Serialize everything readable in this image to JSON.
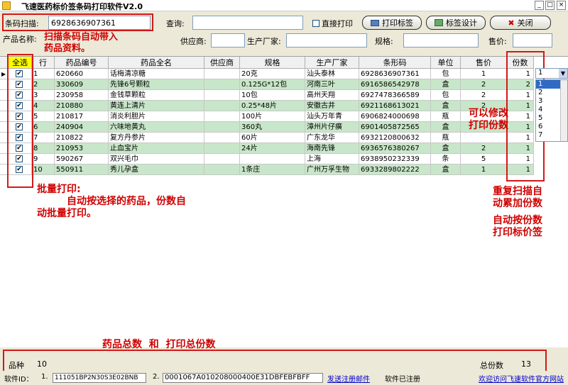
{
  "window": {
    "title": "飞速医药标价签条码打印软件V2.0",
    "min": "_",
    "max": "□",
    "close": "×"
  },
  "toolbar": {
    "scan_label": "条码扫描:",
    "scan_value": "6928636907361",
    "query_label": "查询:",
    "direct_print": "直接打印",
    "print_btn": "打印标签",
    "design_btn": "标签设计",
    "close_btn": "关闭"
  },
  "filters": {
    "name_label": "产品名称:",
    "supplier_label": "供应商:",
    "maker_label": "生产厂家:",
    "spec_label": "规格:",
    "price_label": "售价:"
  },
  "annotations": {
    "scan": "扫描条码自动带入\n药品资料。",
    "modify": "可以修改\n打印份数",
    "batch_title": "批量打印:",
    "batch_body": "自动按选择的药品，份数自\n动批量打印。",
    "repeat": "重复扫描自\n动累加份数",
    "auto": "自动按份数\n打印标价签",
    "total": "药品总数  和  打印总份数"
  },
  "table": {
    "headers": [
      "全选",
      "行",
      "药品编号",
      "药品全名",
      "供应商",
      "规格",
      "生产厂家",
      "条形码",
      "单位",
      "售价",
      "份数"
    ],
    "rows": [
      {
        "row": "1",
        "code": "620660",
        "name": "话梅清凉糖",
        "supplier": "",
        "spec": "20克",
        "maker": "汕头泰林",
        "barcode": "6928636907361",
        "unit": "包",
        "price": "1",
        "qty": "1"
      },
      {
        "row": "2",
        "code": "330609",
        "name": "先锋6号颗粒",
        "supplier": "",
        "spec": "0.125G*12包",
        "maker": "河南三叶",
        "barcode": "6916586542978",
        "unit": "盒",
        "price": "2",
        "qty": "2"
      },
      {
        "row": "3",
        "code": "230958",
        "name": "金钱草颗粒",
        "supplier": "",
        "spec": "10包",
        "maker": "高州天翔",
        "barcode": "6927478366589",
        "unit": "包",
        "price": "2",
        "qty": "1"
      },
      {
        "row": "4",
        "code": "210880",
        "name": "黄连上清片",
        "supplier": "",
        "spec": "0.25*48片",
        "maker": "安徽古井",
        "barcode": "6921168613021",
        "unit": "盒",
        "price": "2",
        "qty": "1"
      },
      {
        "row": "5",
        "code": "210817",
        "name": "消炎利胆片",
        "supplier": "",
        "spec": "100片",
        "maker": "汕头万年青",
        "barcode": "6906824000698",
        "unit": "瓶",
        "price": "",
        "qty": "1"
      },
      {
        "row": "6",
        "code": "240904",
        "name": "六味地黄丸",
        "supplier": "",
        "spec": "360丸",
        "maker": "漳州片仔癀",
        "barcode": "6901405872565",
        "unit": "盒",
        "price": "",
        "qty": "1"
      },
      {
        "row": "7",
        "code": "210822",
        "name": "复方丹参片",
        "supplier": "",
        "spec": "60片",
        "maker": "广东龙华",
        "barcode": "6932120800632",
        "unit": "瓶",
        "price": "",
        "qty": "1"
      },
      {
        "row": "8",
        "code": "210953",
        "name": "止血宝片",
        "supplier": "",
        "spec": "24片",
        "maker": "海南先锋",
        "barcode": "6936576380267",
        "unit": "盒",
        "price": "2",
        "qty": "1"
      },
      {
        "row": "9",
        "code": "590267",
        "name": "双兴毛巾",
        "supplier": "",
        "spec": "",
        "maker": "上海",
        "barcode": "6938950232339",
        "unit": "条",
        "price": "5",
        "qty": "1"
      },
      {
        "row": "10",
        "code": "550911",
        "name": "秀儿孕盒",
        "supplier": "",
        "spec": "1条庄",
        "maker": "广州万孚生物",
        "barcode": "6933289802222",
        "unit": "盒",
        "price": "1",
        "qty": "1"
      }
    ]
  },
  "dropdown": {
    "selected": "1",
    "options": [
      "1",
      "2",
      "3",
      "4",
      "5",
      "6",
      "7"
    ]
  },
  "status": {
    "kinds_label": "品种",
    "kinds_value": "10",
    "total_label": "总份数",
    "total_value": "13"
  },
  "footer": {
    "id_label": "软件ID：",
    "id_field1_no": "1.",
    "id_field1": "111051BP2N30S3E02BNB",
    "id_field2_no": "2.",
    "id_field2": "0001067A010208000400E31DBFEBFBFF",
    "send_mail": "发送注册邮件",
    "registered": "软件已注册",
    "visit": "欢迎访问飞速软件官方网站"
  }
}
